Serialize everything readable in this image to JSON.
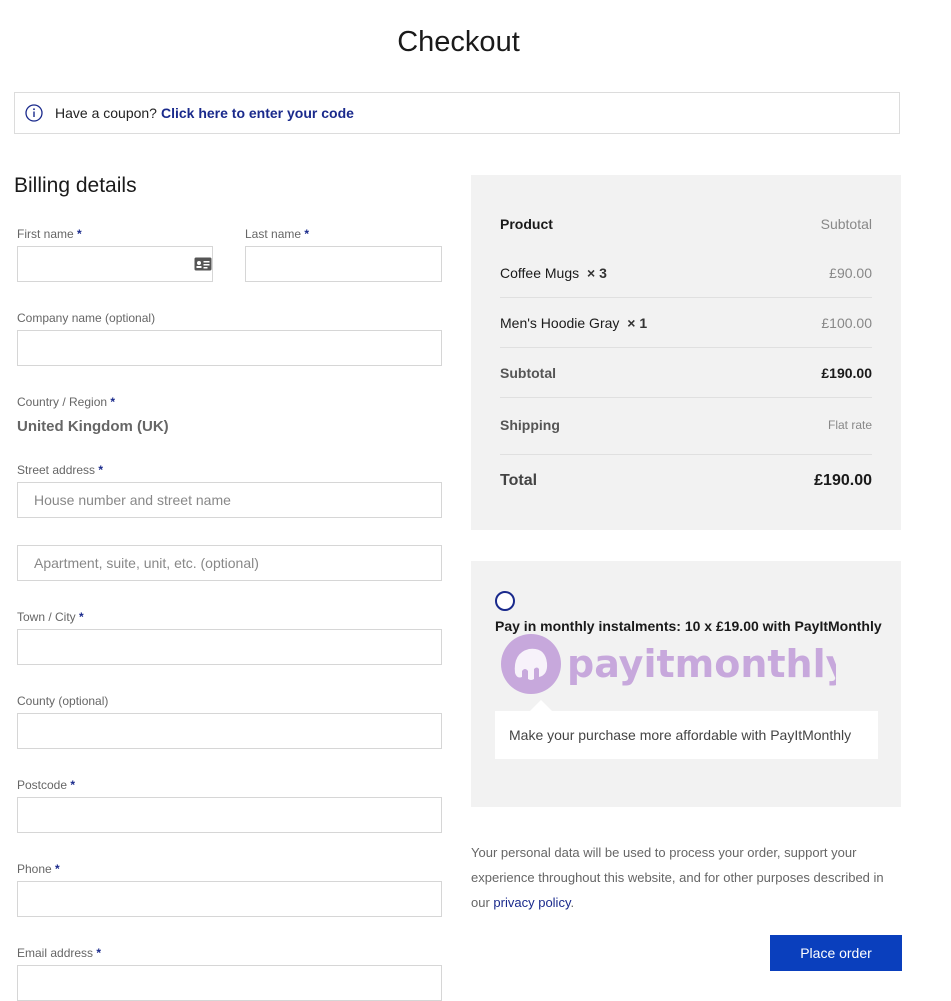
{
  "page": {
    "title": "Checkout"
  },
  "coupon": {
    "prompt": "Have a coupon?",
    "link": "Click here to enter your code",
    "icon": "info-icon"
  },
  "billing": {
    "title": "Billing details",
    "first_name_label": "First name",
    "last_name_label": "Last name",
    "company_label": "Company name (optional)",
    "country_label": "Country / Region",
    "country_value": "United Kingdom (UK)",
    "street_label": "Street address",
    "street_placeholder": "House number and street name",
    "apartment_placeholder": "Apartment, suite, unit, etc. (optional)",
    "town_label": "Town / City",
    "county_label": "County (optional)",
    "postcode_label": "Postcode",
    "phone_label": "Phone",
    "email_label": "Email address",
    "required_mark": "*"
  },
  "order": {
    "header_product": "Product",
    "header_subtotal": "Subtotal",
    "items": [
      {
        "name": "Coffee Mugs",
        "qty": "× 3",
        "price": "£90.00"
      },
      {
        "name": "Men's Hoodie Gray",
        "qty": "× 1",
        "price": "£100.00"
      }
    ],
    "subtotal_label": "Subtotal",
    "subtotal_value": "£190.00",
    "shipping_label": "Shipping",
    "shipping_value": "Flat rate",
    "total_label": "Total",
    "total_value": "£190.00"
  },
  "payment": {
    "option_label": "Pay in monthly instalments: 10 x £19.00 with PayItMonthly",
    "brand": "payitmonthly",
    "description": "Make your purchase more affordable with PayItMonthly"
  },
  "privacy": {
    "text": "Your personal data will be used to process your order, support your experience throughout this website, and for other purposes described in our",
    "link": "privacy policy",
    "end": "."
  },
  "actions": {
    "place_order": "Place order"
  },
  "colors": {
    "accent": "#1a2a8c",
    "button": "#0a3fbd",
    "brand_purple": "#c7a8dc"
  }
}
